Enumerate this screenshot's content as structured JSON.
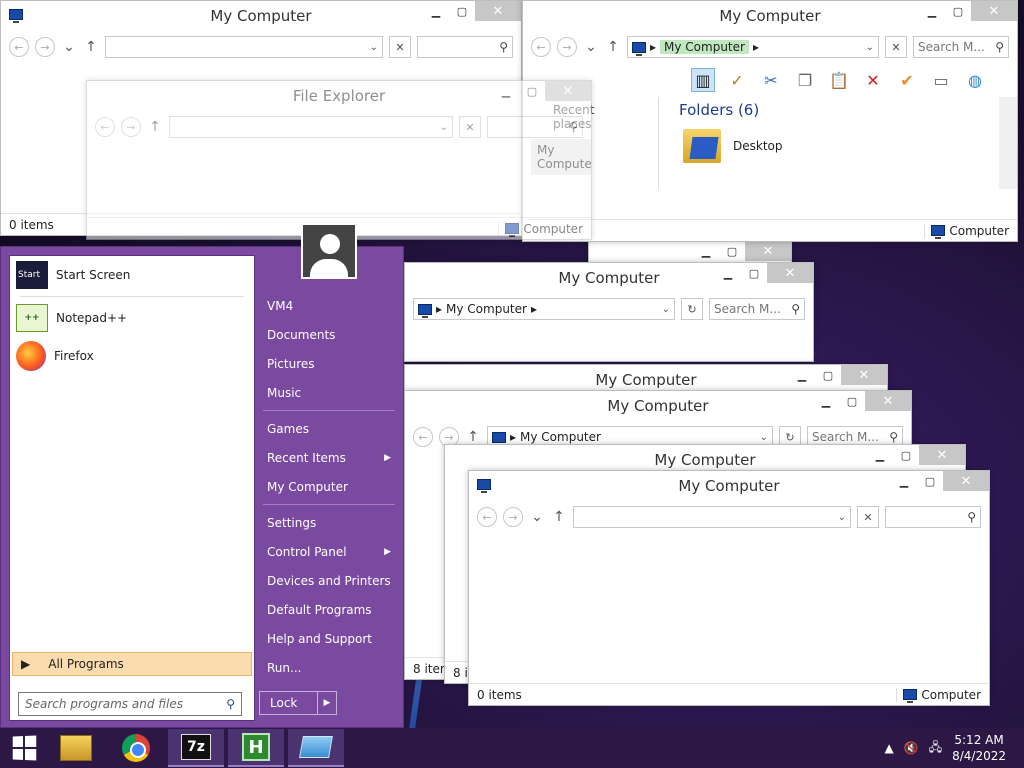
{
  "window_title": "My Computer",
  "explorer_title": "File Explorer",
  "address_my_computer": "My Computer",
  "search_placeholder": "Search M...",
  "status_items_0": "0 items",
  "status_items_8": "8 items",
  "status_location": "Computer",
  "nav_pane": [
    "Recent places",
    "My Computer"
  ],
  "folders_header": "Folders (6)",
  "folder_desktop": "Desktop",
  "start_menu": {
    "pinned": [
      {
        "label": "Start Screen",
        "icon": "start-screen-icon"
      },
      {
        "label": "Notepad++",
        "icon": "notepad-plus-plus-icon"
      },
      {
        "label": "Firefox",
        "icon": "firefox-icon"
      }
    ],
    "all_programs": "All Programs",
    "search_placeholder": "Search programs and files",
    "links": {
      "vm4": "VM4",
      "documents": "Documents",
      "pictures": "Pictures",
      "music": "Music",
      "games": "Games",
      "recent_items": "Recent Items",
      "my_computer": "My Computer",
      "settings": "Settings",
      "control_panel": "Control Panel",
      "devices_printers": "Devices and Printers",
      "default_programs": "Default Programs",
      "help_support": "Help and Support",
      "run": "Run..."
    },
    "lock": "Lock",
    "start_tile_text": "Start"
  },
  "taskbar": {
    "apps": [
      "file-explorer-icon",
      "chrome-icon",
      "7zip-icon",
      "hxd-icon",
      "window-switcher-icon"
    ],
    "seven_zip_label": "7z",
    "hxd_label": "H",
    "time": "5:12 AM",
    "date": "8/4/2022"
  },
  "colors": {
    "start_menu": "#7a4aa0",
    "taskbar": "#2d1845",
    "all_programs_highlight": "#fbdcae"
  }
}
